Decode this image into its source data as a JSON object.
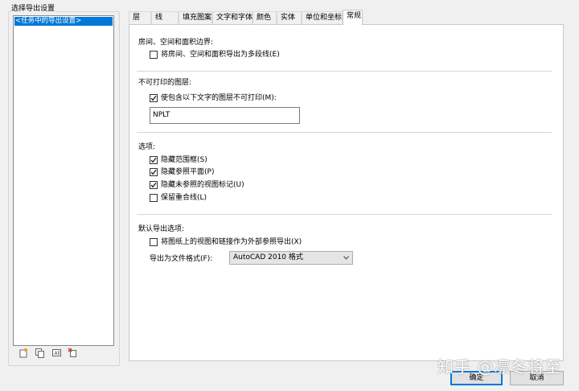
{
  "left": {
    "group_label": "选择导出设置",
    "list_item": "<任务中的导出设置>",
    "toolbar": [
      "new-setting-icon",
      "copy-setting-icon",
      "rename-setting-icon",
      "delete-setting-icon"
    ]
  },
  "tabs": [
    "层",
    "线",
    "填充图案",
    "文字和字体",
    "颜色",
    "实体",
    "单位和坐标",
    "常规"
  ],
  "active_tab": "常规",
  "sections": {
    "rooms": {
      "heading": "房间、空间和面积边界:",
      "checkbox_label": "将房间、空间和面积导出为多段线(E)",
      "checked": false
    },
    "nonplot": {
      "heading": "不可打印的图层:",
      "checkbox_label": "使包含以下文字的图层不可打印(M):",
      "checked": true,
      "field_value": "NPLT"
    },
    "options": {
      "heading": "选项:",
      "items": [
        {
          "label": "隐藏范围框(S)",
          "checked": true
        },
        {
          "label": "隐藏参照平面(P)",
          "checked": true
        },
        {
          "label": "隐藏未参照的视图标记(U)",
          "checked": true
        },
        {
          "label": "保留重合线(L)",
          "checked": false
        }
      ]
    },
    "defaults": {
      "heading": "默认导出选项:",
      "checkbox_label": "将图纸上的视图和链接作为外部参照导出(X)",
      "checked": false,
      "format_label": "导出为文件格式(F):",
      "format_value": "AutoCAD 2010 格式"
    }
  },
  "buttons": {
    "ok": "确定",
    "cancel": "取消"
  },
  "watermark": "知乎 @凛冬将至",
  "colors": {
    "selection": "#0078d7",
    "panel": "#ffffff",
    "background": "#f0f0f0"
  }
}
